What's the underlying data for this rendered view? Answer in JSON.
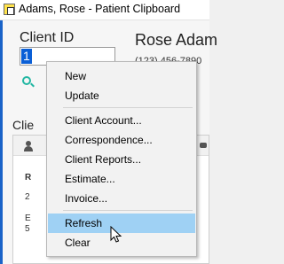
{
  "window": {
    "title": "Adams, Rose - Patient Clipboard"
  },
  "client": {
    "id_label": "Client ID",
    "id_value": "1",
    "name": "Rose Adam",
    "phone": "(123) 456-7890",
    "section_label": "Clie"
  },
  "card": {
    "line1": "R",
    "line2": "2",
    "line3": "E",
    "line4": "5"
  },
  "context_menu": {
    "items": [
      {
        "label": "New"
      },
      {
        "label": "Update"
      },
      {
        "label": "Client Account..."
      },
      {
        "label": "Correspondence..."
      },
      {
        "label": "Client Reports..."
      },
      {
        "label": "Estimate..."
      },
      {
        "label": "Invoice..."
      },
      {
        "label": "Refresh"
      },
      {
        "label": "Clear"
      }
    ],
    "highlighted": "Refresh"
  },
  "colors": {
    "accent": "#1a63c8",
    "selection": "#0a5fd6",
    "menu_highlight": "#9fd1f4",
    "search_icon": "#23b7a3"
  }
}
